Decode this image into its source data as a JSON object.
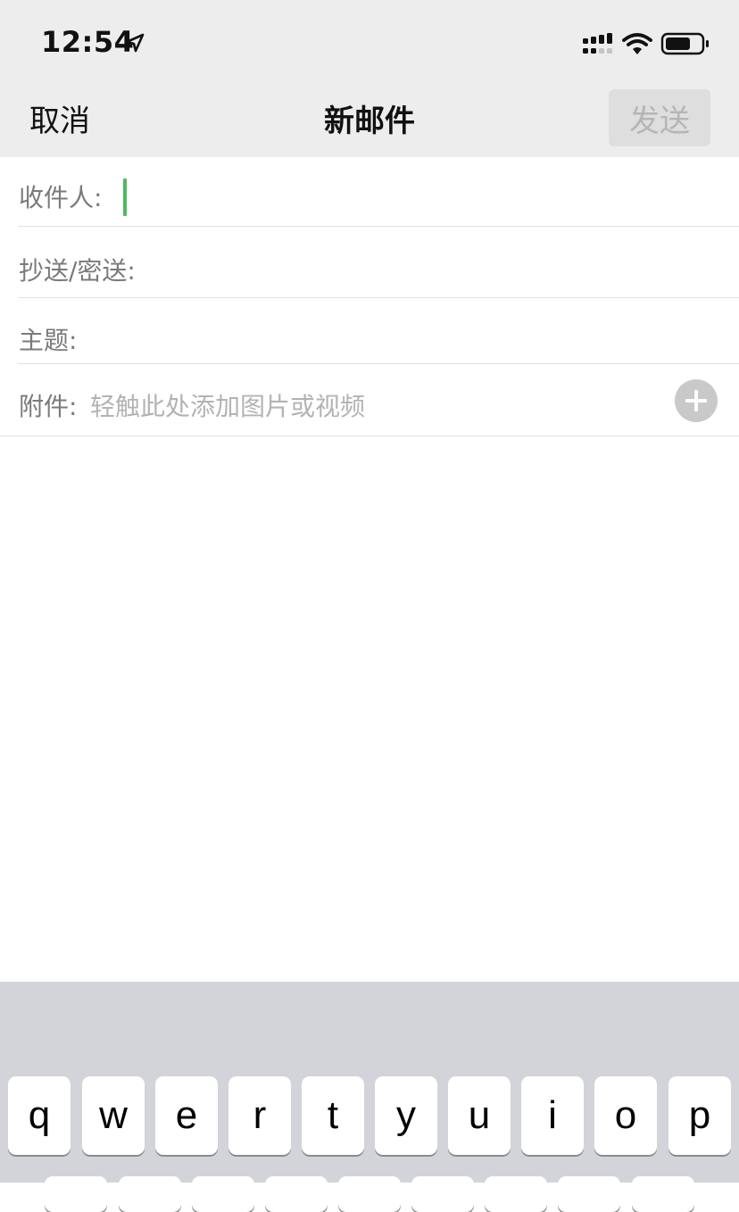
{
  "status_bar": {
    "time": "12:54"
  },
  "nav": {
    "cancel_label": "取消",
    "title": "新邮件",
    "send_label": "发送"
  },
  "form": {
    "to_label": "收件人:",
    "cc_bcc_label": "抄送/密送:",
    "subject_label": "主题:",
    "attachment_label": "附件:",
    "attachment_hint": "轻触此处添加图片或视频"
  },
  "keyboard": {
    "row1": [
      "q",
      "w",
      "e",
      "r",
      "t",
      "y",
      "u",
      "i",
      "o",
      "p"
    ]
  },
  "colors": {
    "caret": "#4cbb5c",
    "nav_background": "#ededed",
    "send_button_disabled": "#dedede",
    "keyboard_background": "#d3d4d9"
  },
  "icons": [
    "location-arrow-icon",
    "signal-icon",
    "wifi-icon",
    "battery-icon",
    "add-circle-icon"
  ]
}
